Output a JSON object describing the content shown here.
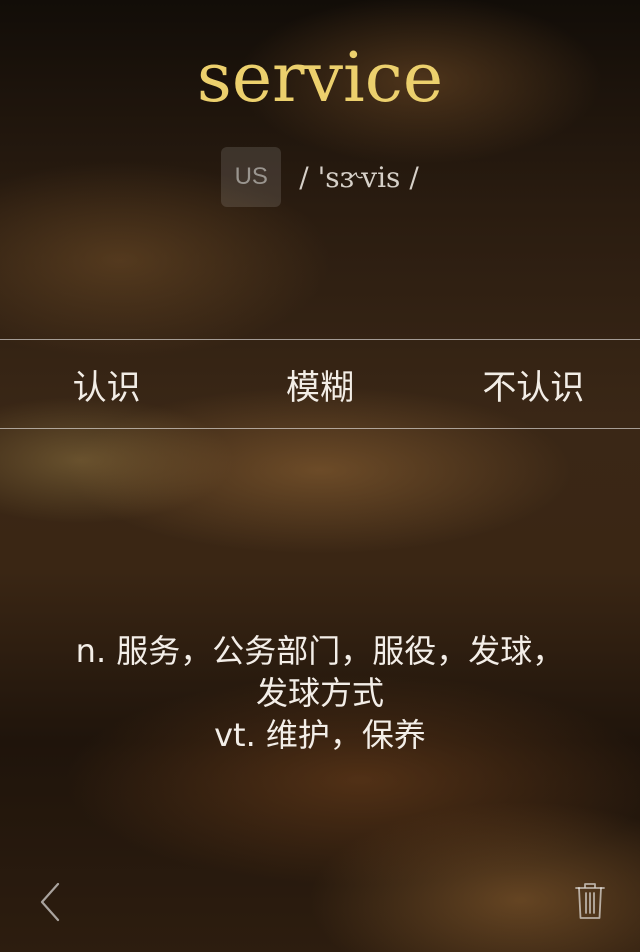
{
  "word": {
    "headword": "service",
    "accent_label": "US",
    "phonetic": "/ 'sɝvis /"
  },
  "rating": {
    "known": "认识",
    "fuzzy": "模糊",
    "unknown": "不认识"
  },
  "definition": {
    "lines": [
      "n. 服务，公务部门，服役，发球，",
      "发球方式",
      "vt. 维护，保养"
    ]
  },
  "footer": {
    "back_icon": "chevron-left-icon",
    "delete_icon": "trash-icon"
  },
  "colors": {
    "headword": "#ecd06d",
    "text": "#f2ede6",
    "divider": "rgba(255,255,255,0.55)"
  }
}
